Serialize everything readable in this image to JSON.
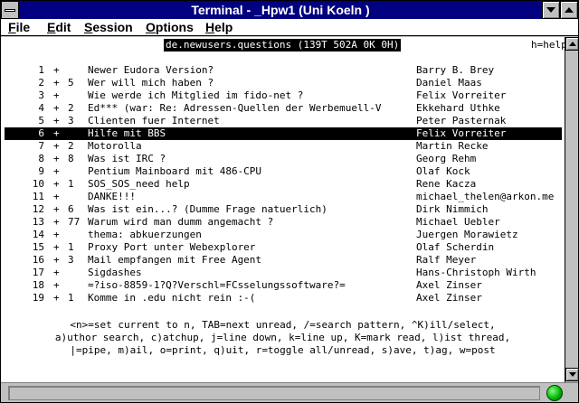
{
  "window": {
    "title": "Terminal - _Hpw1 (Uni Koeln )",
    "menus": [
      {
        "label": "File",
        "mnemonic": "F",
        "rest": "ile"
      },
      {
        "label": "Edit",
        "mnemonic": "E",
        "rest": "dit"
      },
      {
        "label": "Session",
        "mnemonic": "S",
        "rest": "ession"
      },
      {
        "label": "Options",
        "mnemonic": "O",
        "rest": "ptions"
      },
      {
        "label": "Help",
        "mnemonic": "H",
        "rest": "elp"
      }
    ]
  },
  "terminal": {
    "header": "de.newusers.questions (139T 502A 0K 0H)",
    "header_right": "h=help",
    "selected_index": 5,
    "threads": [
      {
        "num": "1",
        "flag": "+",
        "count": "",
        "subject": "Newer Eudora Version?",
        "author": "Barry B. Brey"
      },
      {
        "num": "2",
        "flag": "+",
        "count": "5",
        "subject": "Wer will mich haben ?",
        "author": "Daniel Maas"
      },
      {
        "num": "3",
        "flag": "+",
        "count": "",
        "subject": "Wie werde ich Mitglied im fido-net ?",
        "author": "Felix Vorreiter"
      },
      {
        "num": "4",
        "flag": "+",
        "count": "2",
        "subject": "Ed*** (war: Re: Adressen-Quellen der Werbemuell-V",
        "author": "Ekkehard Uthke"
      },
      {
        "num": "5",
        "flag": "+",
        "count": "3",
        "subject": "Clienten fuer Internet",
        "author": "Peter Pasternak"
      },
      {
        "num": "6",
        "flag": "+",
        "count": "",
        "subject": "Hilfe mit BBS",
        "author": "Felix Vorreiter"
      },
      {
        "num": "7",
        "flag": "+",
        "count": "2",
        "subject": "Motorolla",
        "author": "Martin Recke"
      },
      {
        "num": "8",
        "flag": "+",
        "count": "8",
        "subject": "Was ist IRC ?",
        "author": "Georg Rehm"
      },
      {
        "num": "9",
        "flag": "+",
        "count": "",
        "subject": "Pentium Mainboard mit 486-CPU",
        "author": "Olaf Kock"
      },
      {
        "num": "10",
        "flag": "+",
        "count": "1",
        "subject": "SOS_SOS_need help",
        "author": "Rene Kacza"
      },
      {
        "num": "11",
        "flag": "+",
        "count": "",
        "subject": "DANKE!!!",
        "author": "michael_thelen@arkon.me"
      },
      {
        "num": "12",
        "flag": "+",
        "count": "6",
        "subject": "Was ist ein...? (Dumme Frage natuerlich)",
        "author": "Dirk Nimmich"
      },
      {
        "num": "13",
        "flag": "+",
        "count": "77",
        "subject": "Warum wird man dumm angemacht ?",
        "author": "Michael Uebler"
      },
      {
        "num": "14",
        "flag": "+",
        "count": "",
        "subject": "thema: abkuerzungen",
        "author": "Juergen Morawietz"
      },
      {
        "num": "15",
        "flag": "+",
        "count": "1",
        "subject": "Proxy Port unter Webexplorer",
        "author": "Olaf Scherdin"
      },
      {
        "num": "16",
        "flag": "+",
        "count": "3",
        "subject": "Mail empfangen mit Free Agent",
        "author": "Ralf Meyer"
      },
      {
        "num": "17",
        "flag": "+",
        "count": "",
        "subject": "Sigdashes",
        "author": "Hans-Christoph Wirth"
      },
      {
        "num": "18",
        "flag": "+",
        "count": "",
        "subject": "=?iso-8859-1?Q?Verschl=FCsselungssoftware?=",
        "author": "Axel Zinser"
      },
      {
        "num": "19",
        "flag": "+",
        "count": "1",
        "subject": "Komme in .edu nicht rein :-(",
        "author": "Axel Zinser"
      }
    ],
    "help_lines": [
      "<n>=set current to n, TAB=next unread, /=search pattern, ^K)ill/select,",
      "a)uthor search, c)atchup, j=line down, k=line up, K=mark read, l)ist thread,",
      "|=pipe, m)ail, o=print, q)uit, r=toggle all/unread, s)ave, t)ag, w=post"
    ]
  },
  "status": {
    "text": "",
    "led_color": "#00c000"
  },
  "colors": {
    "titlebar": "#000080",
    "chrome": "#c0c0c0",
    "terminal_bg": "#ffffff"
  },
  "icons": {
    "system_menu": "system-menu-icon",
    "minimize": "minimize-icon",
    "maximize": "maximize-icon",
    "scroll_up": "scroll-up-icon",
    "scroll_down": "scroll-down-icon",
    "connection": "connection-status-icon"
  }
}
